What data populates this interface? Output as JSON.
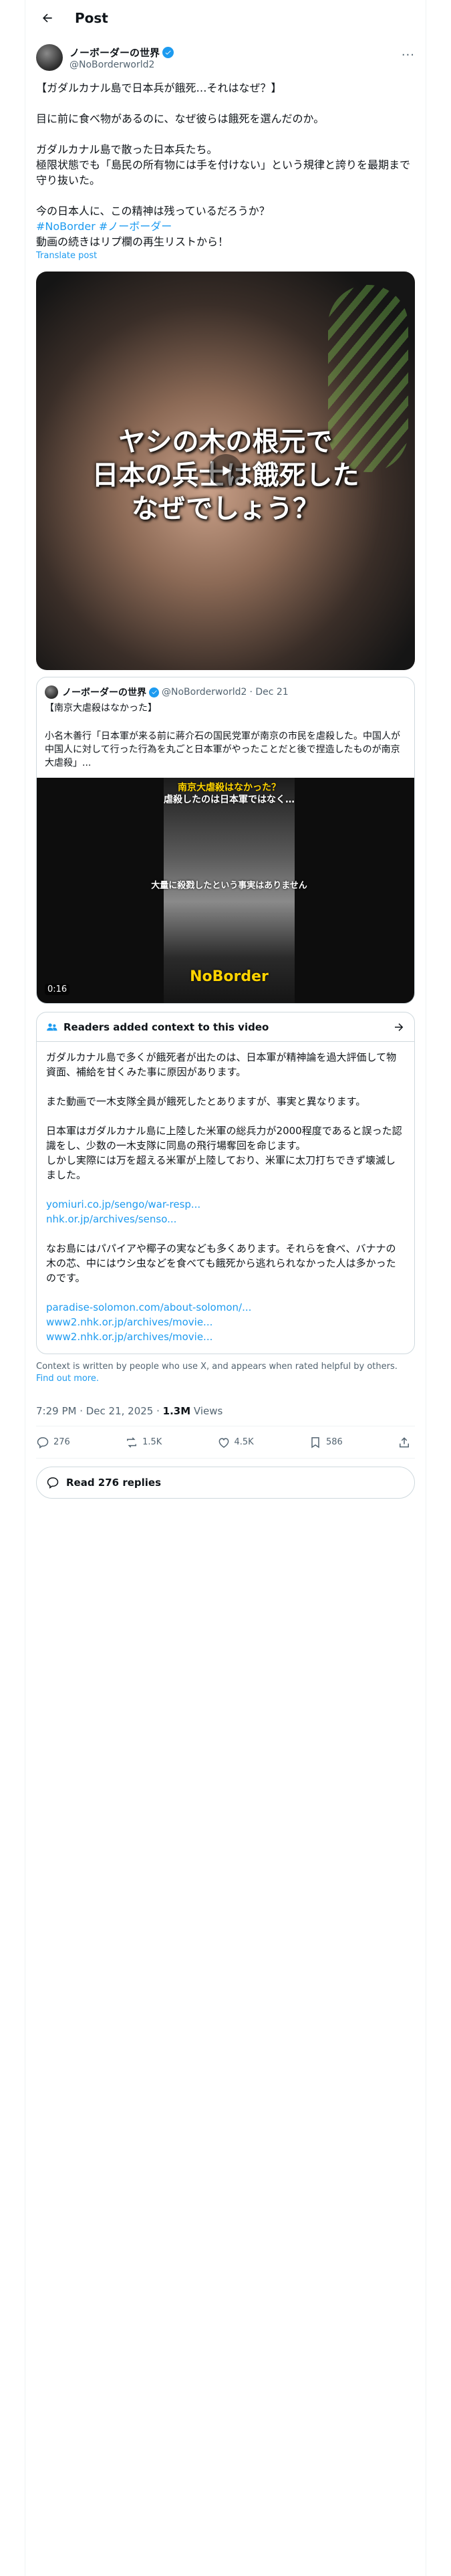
{
  "header": {
    "title": "Post"
  },
  "post": {
    "author": {
      "name": "ノーボーダーの世界",
      "handle": "@NoBorderworld2"
    },
    "lines": [
      "【ガダルカナル島で日本兵が餓死…それはなぜ？】",
      "",
      "目に前に食べ物があるのに、なぜ彼らは餓死を選んだのか。",
      "",
      "ガダルカナル島で散った日本兵たち。",
      "極限状態でも「島民の所有物には手を付けない」という規律と誇りを最期まで守り抜いた。",
      "",
      "今の日本人に、この精神は残っているだろうか？"
    ],
    "hashtags": "#NoBorder #ノーボーダー",
    "last_line": "動画の続きはリプ欄の再生リストから！",
    "translate": "Translate post",
    "video_caption_1": "ヤシの木の根元で",
    "video_caption_2": "日本の兵士は餓死した",
    "video_caption_3": "なぜでしょう？"
  },
  "quote": {
    "name": "ノーボーダーの世界",
    "handle": "@NoBorderworld2",
    "date": "· Dec 21",
    "title": "【南京大虐殺はなかった】",
    "body": "小名木善行「日本軍が来る前に蔣介石の国民党軍が南京の市民を虐殺した。中国人が中国人に対して行った行為を丸ごと日本軍がやったことだと後で捏造したものが南京大虐殺」...",
    "media_top": "南京大虐殺はなかった？",
    "media_top2": "虐殺したのは日本軍ではなく…",
    "media_mid": "大量に殺戮したという事実はありません",
    "media_brand": "NoBorder",
    "duration": "0:16"
  },
  "community_note": {
    "title": "Readers added context to this video",
    "p1": "ガダルカナル島で多くが餓死者が出たのは、日本軍が精神論を過大評価して物資面、補給を甘くみた事に原因があります。",
    "p2": "また動画で一木支隊全員が餓死したとありますが、事実と異なります。",
    "p3": "日本軍はガダルカナル島に上陸した米軍の総兵力が2000程度であると誤った認識をし、少数の一木支隊に同島の飛行場奪回を命じます。\nしかし実際には万を超える米軍が上陸しており、米軍に太刀打ちできず壊滅しました。",
    "links1": [
      "yomiuri.co.jp/sengo/war-resp...",
      "nhk.or.jp/archives/senso..."
    ],
    "p4": "なお島にはパパイアや椰子の実なども多くあります。それらを食べ、バナナの木の芯、中にはウシ虫などを食べても餓死から逃れられなかった人は多かったのです。",
    "links2": [
      "paradise-solomon.com/about-solomon/...",
      "www2.nhk.or.jp/archives/movie...",
      "www2.nhk.or.jp/archives/movie..."
    ],
    "footer": "Context is written by people who use X, and appears when rated helpful by others.",
    "footer_link": "Find out more."
  },
  "meta": {
    "time": "7:29 PM · Dec 21, 2025 · ",
    "views": "1.3M",
    "views_label": " Views"
  },
  "actions": {
    "replies": "276",
    "reposts": "1.5K",
    "likes": "4.5K",
    "bookmarks": "586"
  },
  "read_replies": "Read 276 replies",
  "colors": {
    "accent": "#1d9bf0",
    "text": "#0f1419",
    "muted": "#536471",
    "border": "#cfd9de"
  }
}
